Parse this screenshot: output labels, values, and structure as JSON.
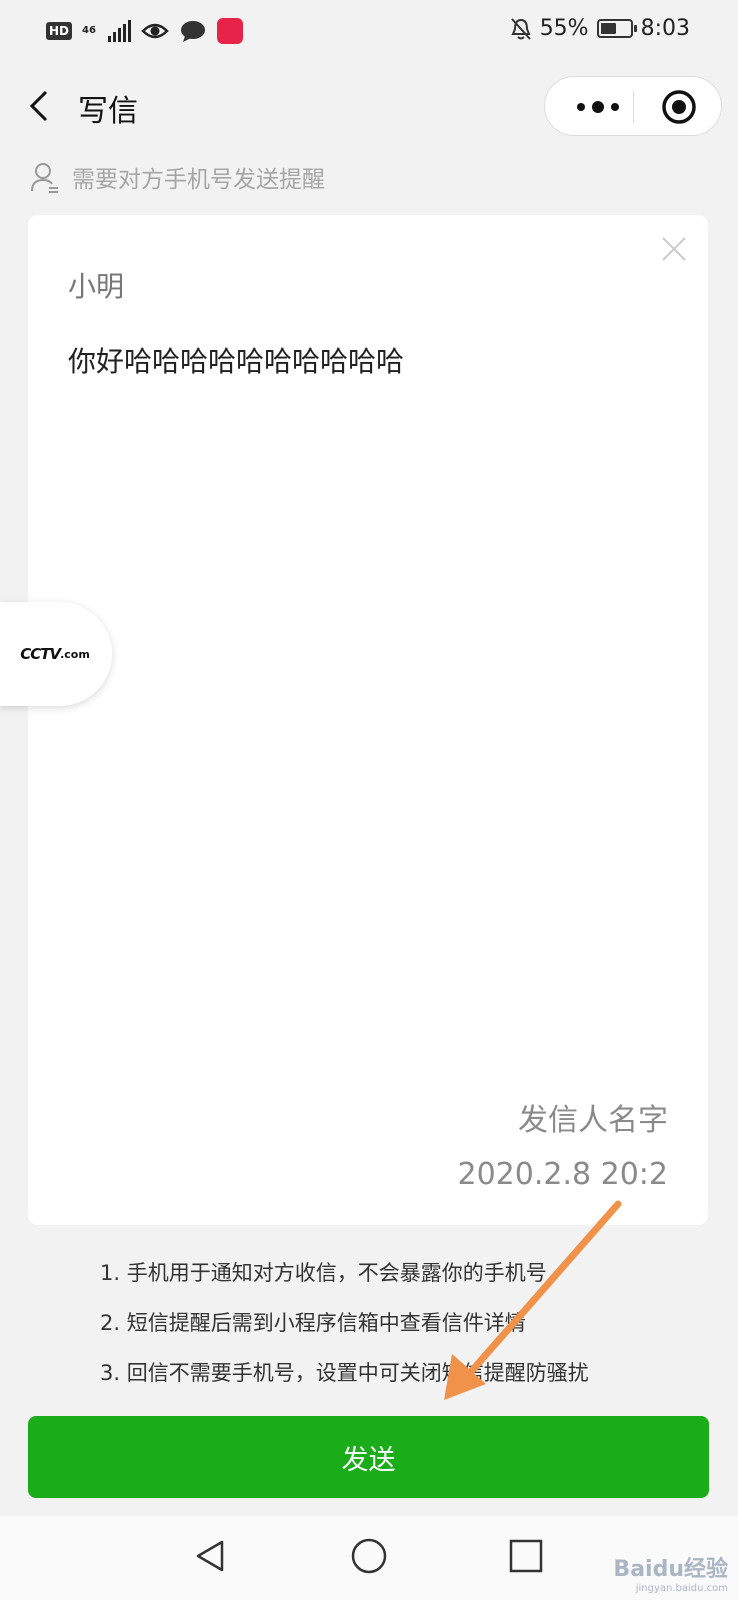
{
  "status_bar": {
    "hd": "HD",
    "network": "46",
    "battery_text": "55%",
    "battery_level": 0.55,
    "time": "8:03"
  },
  "nav": {
    "title": "写信"
  },
  "recipient_hint": "需要对方手机号发送提醒",
  "letter": {
    "recipient": "小明",
    "body": "你好哈哈哈哈哈哈哈哈哈哈",
    "sender": "发信人名字",
    "date": "2020.2.8 20:2"
  },
  "notes": [
    "1. 手机用于通知对方收信，不会暴露你的手机号",
    "2. 短信提醒后需到小程序信箱中查看信件详情",
    "3. 回信不需要手机号，设置中可关闭短信提醒防骚扰"
  ],
  "send_label": "发送",
  "floating_logo": {
    "text": "CCTV",
    "suffix": ".com"
  },
  "watermark": {
    "brand": "Baidu经验",
    "url": "jingyan.baidu.com"
  },
  "colors": {
    "primary_green": "#1aad19",
    "arrow": "#f0924a"
  }
}
